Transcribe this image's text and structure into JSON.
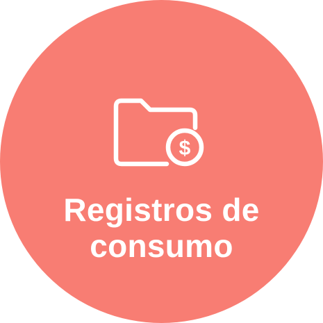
{
  "tile": {
    "background_color": "#f87d73",
    "icon": "folder-dollar-icon",
    "label_line1": "Registros de",
    "label_line2": "consumo"
  }
}
